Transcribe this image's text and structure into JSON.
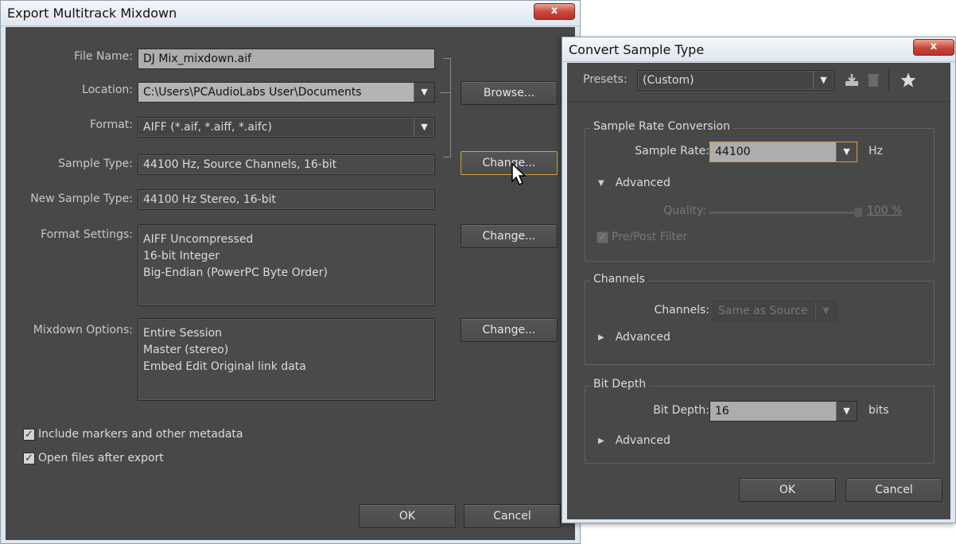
{
  "export_dialog": {
    "title": "Export Multitrack Mixdown",
    "close_glyph": "x",
    "file_name_label": "File Name:",
    "file_name_value": "DJ Mix_mixdown.aif",
    "location_label": "Location:",
    "location_value": "C:\\Users\\PCAudioLabs User\\Documents",
    "browse_label": "Browse...",
    "format_label": "Format:",
    "format_value": "AIFF (*.aif, *.aiff, *.aifc)",
    "sample_type_label": "Sample Type:",
    "sample_type_value": "44100 Hz, Source Channels, 16-bit",
    "change_label": "Change...",
    "new_sample_type_label": "New Sample Type:",
    "new_sample_type_value": "44100 Hz Stereo, 16-bit",
    "format_settings_label": "Format Settings:",
    "format_settings_lines": [
      "AIFF Uncompressed",
      "16-bit Integer",
      "Big-Endian (PowerPC Byte Order)"
    ],
    "mixdown_options_label": "Mixdown Options:",
    "mixdown_options_lines": [
      "Entire Session",
      "Master (stereo)",
      "Embed Edit Original link data"
    ],
    "include_markers_label": "Include markers and other metadata",
    "include_markers_checked": true,
    "open_files_label": "Open files after export",
    "open_files_checked": true,
    "ok_label": "OK",
    "cancel_label": "Cancel"
  },
  "convert_dialog": {
    "title": "Convert Sample Type",
    "close_glyph": "x",
    "presets_label": "Presets:",
    "presets_value": "(Custom)",
    "sample_rate_group": "Sample Rate Conversion",
    "sample_rate_label": "Sample Rate:",
    "sample_rate_value": "44100",
    "sample_rate_unit": "Hz",
    "advanced_label": "Advanced",
    "quality_label": "Quality:",
    "quality_value": "100 %",
    "quality_fraction": 1.0,
    "pre_post_filter_label": "Pre/Post Filter",
    "pre_post_filter_checked": true,
    "channels_group": "Channels",
    "channels_label": "Channels:",
    "channels_value": "Same as Source",
    "bit_depth_group": "Bit Depth",
    "bit_depth_label": "Bit Depth:",
    "bit_depth_value": "16",
    "bit_depth_unit": "bits",
    "ok_label": "OK",
    "cancel_label": "Cancel"
  },
  "glyphs": {
    "dropdown": "▼",
    "expanded": "▼",
    "collapsed": "▶",
    "check": "✓"
  },
  "colors": {
    "dialog_bg": "#484848",
    "focus_outline": "#d1a23a",
    "close_button": "#c9453a"
  }
}
